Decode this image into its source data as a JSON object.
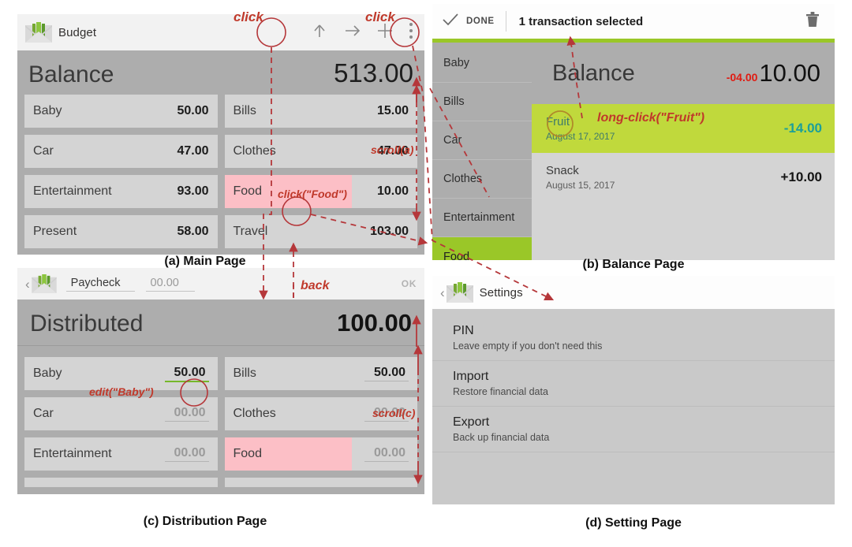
{
  "figure": {
    "captions": {
      "a": "(a) Main Page",
      "b": "(b) Balance Page",
      "c": "(c) Distribution Page",
      "d": "(d) Setting Page"
    },
    "annotations": {
      "click_up": "click",
      "click_menu": "click",
      "click_food": "click(\"Food\")",
      "scroll_a": "scroll(a)",
      "long_click_fruit": "long-click(\"Fruit\")",
      "edit_baby": "edit(\"Baby\")",
      "scroll_c": "scroll(c)",
      "back": "back"
    },
    "annotation_color": "#c0392b"
  },
  "colors": {
    "accent_green": "#9ac728",
    "selected_row": "#c0d93c",
    "selected_text": "#1b9f9a",
    "negative_red": "#e01b12",
    "highlight_pink": "#fcbfc6",
    "panel_gray": "#adadad",
    "cell_gray": "#d4d4d4"
  },
  "main_page": {
    "appbar": {
      "title": "Budget",
      "logo_icon": "budget-envelope-logo-icon",
      "actions": [
        {
          "icon": "arrow-up-circle-icon",
          "name": "upload-action"
        },
        {
          "icon": "arrow-right-icon",
          "name": "transfer-action"
        },
        {
          "icon": "plus-icon",
          "name": "add-action"
        },
        {
          "icon": "overflow-menu-icon",
          "name": "overflow-menu"
        }
      ]
    },
    "balance": {
      "label": "Balance",
      "value": "513.00"
    },
    "categories": [
      {
        "name": "Baby",
        "value": "50.00",
        "highlight": false
      },
      {
        "name": "Bills",
        "value": "15.00",
        "highlight": false
      },
      {
        "name": "Car",
        "value": "47.00",
        "highlight": false
      },
      {
        "name": "Clothes",
        "value": "47.00",
        "highlight": false
      },
      {
        "name": "Entertainment",
        "value": "93.00",
        "highlight": false
      },
      {
        "name": "Food",
        "value": "10.00",
        "highlight": true
      },
      {
        "name": "Present",
        "value": "58.00",
        "highlight": false
      },
      {
        "name": "Travel",
        "value": "103.00",
        "highlight": false
      }
    ]
  },
  "balance_page": {
    "appbar": {
      "done_label": "DONE",
      "done_icon": "check-icon",
      "selection_text": "1 transaction selected",
      "delete_icon": "trash-icon"
    },
    "tabs": [
      {
        "label": "Baby",
        "active": false
      },
      {
        "label": "Bills",
        "active": false
      },
      {
        "label": "Car",
        "active": false
      },
      {
        "label": "Clothes",
        "active": false
      },
      {
        "label": "Entertainment",
        "active": false
      },
      {
        "label": "Food",
        "active": true
      }
    ],
    "header": {
      "label": "Balance",
      "delta": "-04.00",
      "value": "10.00"
    },
    "transactions": [
      {
        "name": "Fruit",
        "date": "August 17, 2017",
        "amount": "-14.00",
        "selected": true
      },
      {
        "name": "Snack",
        "date": "August 15, 2017",
        "amount": "+10.00",
        "selected": false
      }
    ]
  },
  "distribution_page": {
    "appbar": {
      "back_icon": "back-chevron-icon",
      "logo_icon": "budget-envelope-logo-icon",
      "paycheck_label": "Paycheck",
      "amount_placeholder": "00.00",
      "ok_label": "OK"
    },
    "header": {
      "label": "Distributed",
      "value": "100.00"
    },
    "categories": [
      {
        "name": "Baby",
        "value": "50.00",
        "placeholder": false,
        "focused": true,
        "highlight": false
      },
      {
        "name": "Bills",
        "value": "50.00",
        "placeholder": false,
        "focused": false,
        "highlight": false
      },
      {
        "name": "Car",
        "value": "00.00",
        "placeholder": true,
        "focused": false,
        "highlight": false
      },
      {
        "name": "Clothes",
        "value": "00.00",
        "placeholder": true,
        "focused": false,
        "highlight": false
      },
      {
        "name": "Entertainment",
        "value": "00.00",
        "placeholder": true,
        "focused": false,
        "highlight": false
      },
      {
        "name": "Food",
        "value": "00.00",
        "placeholder": true,
        "focused": false,
        "highlight": true
      }
    ]
  },
  "settings_page": {
    "appbar": {
      "back_icon": "back-chevron-icon",
      "logo_icon": "budget-envelope-logo-icon",
      "title": "Settings"
    },
    "items": [
      {
        "title": "PIN",
        "subtitle": "Leave empty if you don't need this"
      },
      {
        "title": "Import",
        "subtitle": "Restore financial data"
      },
      {
        "title": "Export",
        "subtitle": "Back up financial data"
      }
    ]
  }
}
